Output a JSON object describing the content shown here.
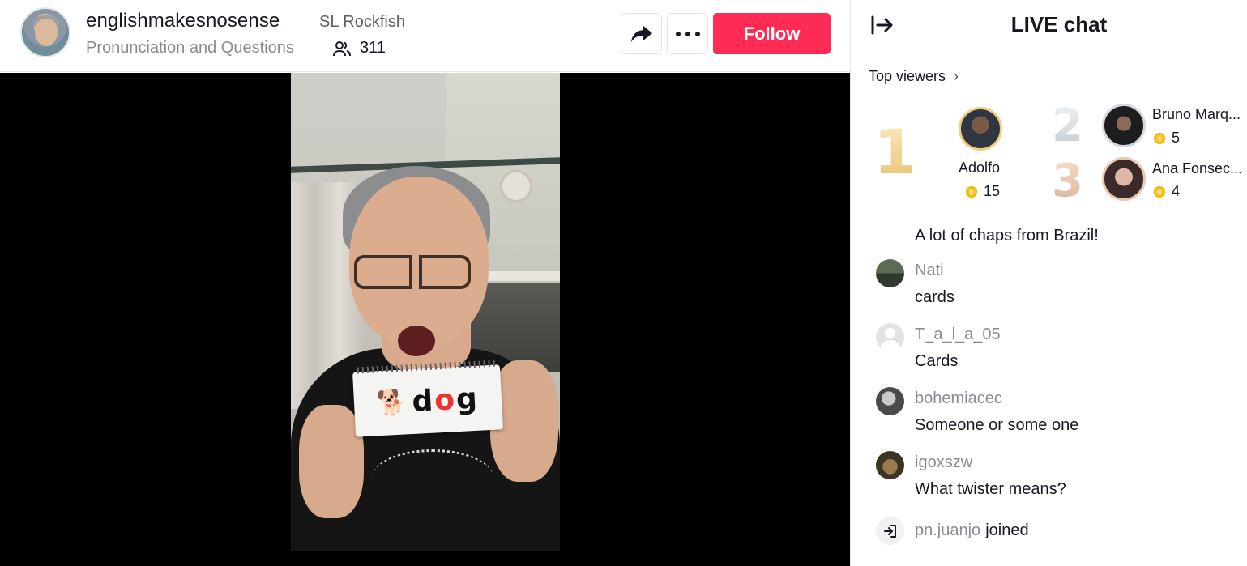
{
  "host": {
    "name": "englishmakesnosense",
    "badge": "SL Rockfish",
    "subtitle": "Pronunciation and Questions",
    "viewer_count": "311"
  },
  "actions": {
    "follow_label": "Follow",
    "share_icon": "share-arrow-icon",
    "more_icon": "more-dots-icon"
  },
  "video": {
    "card_word": "dog"
  },
  "chat": {
    "title": "LIVE chat",
    "top_viewers_label": "Top viewers",
    "top_viewers": [
      {
        "rank": "1",
        "name": "Adolfo",
        "coins": "15"
      },
      {
        "rank": "2",
        "name": "Bruno Marq...",
        "coins": "5"
      },
      {
        "rank": "3",
        "name": "Ana Fonsec...",
        "coins": "4"
      }
    ],
    "partial_message": "A lot of chaps from Brazil!",
    "messages": [
      {
        "user": "Nati",
        "text": "cards"
      },
      {
        "user": "T_a_l_a_05",
        "text": "Cards"
      },
      {
        "user": "bohemiacec",
        "text": "Someone or some one"
      },
      {
        "user": "igoxszw",
        "text": "What twister means?"
      }
    ],
    "join_event": {
      "user": "pn.juanjo",
      "text": "joined"
    }
  },
  "colors": {
    "follow": "#fe2c55",
    "text_primary": "#161823",
    "text_secondary": "#8a8b91",
    "coin": "#fcc82d"
  }
}
